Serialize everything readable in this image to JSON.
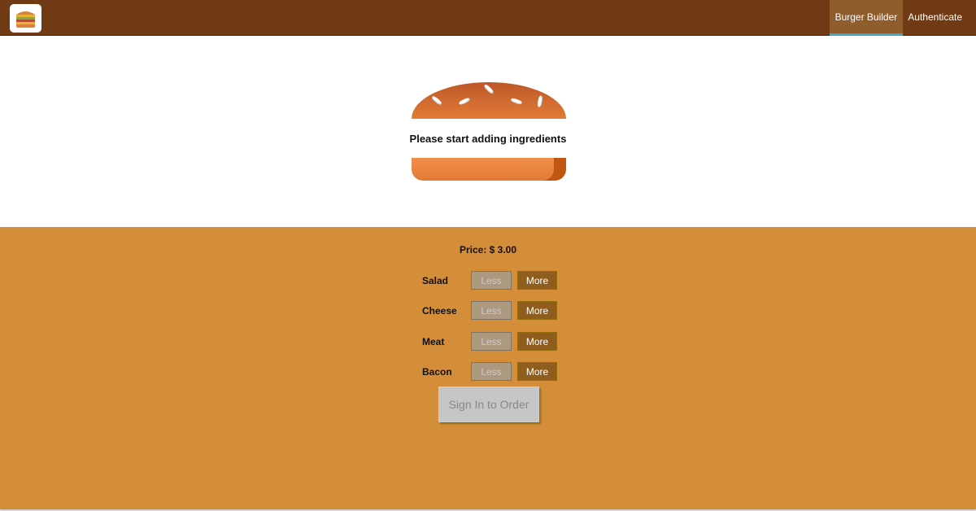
{
  "nav": {
    "logo_alt": "Burger logo",
    "items": [
      {
        "label": "Burger Builder",
        "active": true
      },
      {
        "label": "Authenticate",
        "active": false
      }
    ]
  },
  "burger": {
    "empty_message": "Please start adding ingredients"
  },
  "controls": {
    "price_label": "Price: $ 3.00",
    "less_label": "Less",
    "more_label": "More",
    "ingredients": [
      {
        "label": "Salad"
      },
      {
        "label": "Cheese"
      },
      {
        "label": "Meat"
      },
      {
        "label": "Bacon"
      }
    ],
    "order_label": "Sign In to Order"
  },
  "colors": {
    "toolbar": "#703B14",
    "nav_active": "#8F5C2C",
    "nav_active_underline": "#40A4C8",
    "controls_bg": "#D48E39",
    "more_button": "#8F5E1E",
    "less_button_disabled": "#AC9980",
    "order_button_disabled": "#C7C6C6"
  }
}
